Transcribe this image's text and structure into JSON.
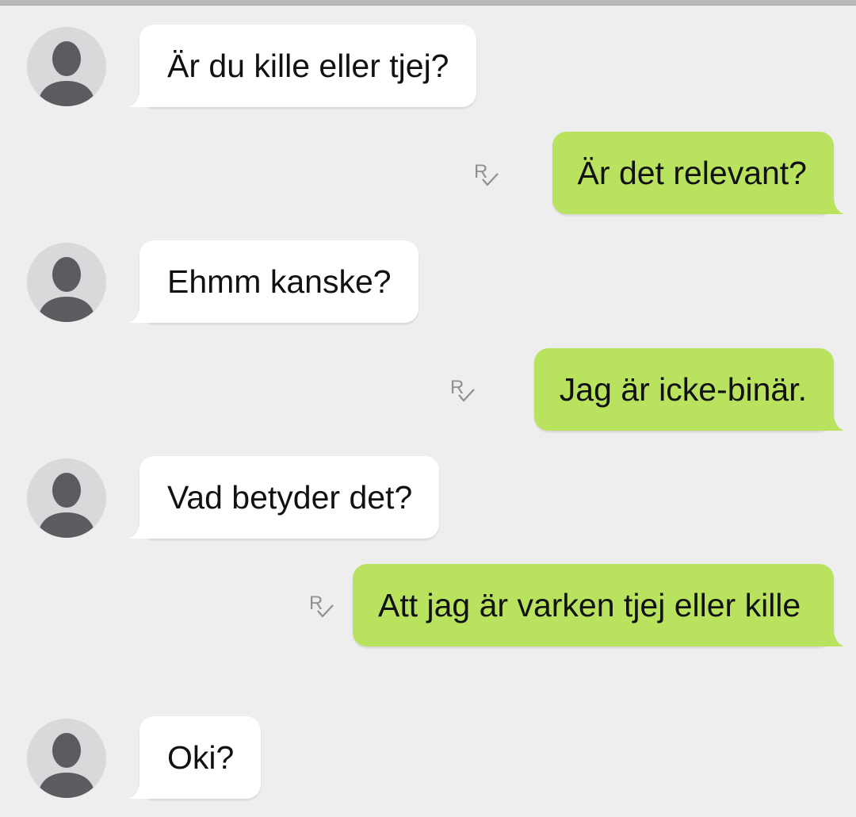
{
  "conversation": {
    "messages": [
      {
        "direction": "incoming",
        "text": "Är du kille eller tjej?"
      },
      {
        "direction": "outgoing",
        "text": "Är det relevant?",
        "receipt": "R"
      },
      {
        "direction": "incoming",
        "text": "Ehmm kanske?"
      },
      {
        "direction": "outgoing",
        "text": "Jag är icke-binär.",
        "receipt": "R"
      },
      {
        "direction": "incoming",
        "text": "Vad betyder det?"
      },
      {
        "direction": "outgoing",
        "text": "Att jag är varken tjej eller kille",
        "receipt": "R"
      },
      {
        "direction": "incoming",
        "text": "Oki?"
      }
    ]
  },
  "icons": {
    "avatar": "default-contact-avatar-icon",
    "receipt": "read-receipt-check-icon"
  },
  "colors": {
    "background": "#eeeeee",
    "incoming_bubble": "#ffffff",
    "outgoing_bubble": "#b9e25f",
    "avatar_bg": "#d9d9db",
    "avatar_figure": "#5b5b60"
  }
}
